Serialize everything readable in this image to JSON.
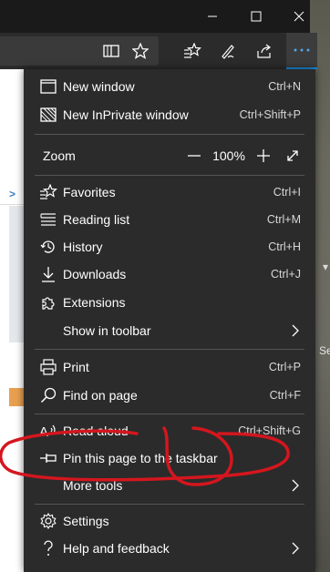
{
  "window": {
    "controls": [
      "minimize",
      "maximize",
      "close"
    ]
  },
  "toolbar": {
    "icons": [
      "reading-view-icon",
      "favorite-star-icon",
      "favorites-hub-icon",
      "pen-icon",
      "share-icon",
      "more-icon"
    ]
  },
  "menu": {
    "new_window": {
      "label": "New window",
      "shortcut": "Ctrl+N"
    },
    "new_inprivate": {
      "label": "New InPrivate window",
      "shortcut": "Ctrl+Shift+P"
    },
    "zoom": {
      "label": "Zoom",
      "value": "100%",
      "minus": "—",
      "plus": "+"
    },
    "favorites": {
      "label": "Favorites",
      "shortcut": "Ctrl+I"
    },
    "reading_list": {
      "label": "Reading list",
      "shortcut": "Ctrl+M"
    },
    "history": {
      "label": "History",
      "shortcut": "Ctrl+H"
    },
    "downloads": {
      "label": "Downloads",
      "shortcut": "Ctrl+J"
    },
    "extensions": {
      "label": "Extensions"
    },
    "show_in_toolbar": {
      "label": "Show in toolbar"
    },
    "print": {
      "label": "Print",
      "shortcut": "Ctrl+P"
    },
    "find_on_page": {
      "label": "Find on page",
      "shortcut": "Ctrl+F"
    },
    "read_aloud": {
      "label": "Read aloud",
      "shortcut": "Ctrl+Shift+G"
    },
    "pin_taskbar": {
      "label": "Pin this page to the taskbar"
    },
    "more_tools": {
      "label": "More tools"
    },
    "settings": {
      "label": "Settings"
    },
    "help": {
      "label": "Help and feedback"
    }
  },
  "background": {
    "page_link_glyph": ">",
    "right_text": "Se"
  },
  "colors": {
    "menu_bg": "#2b2b2b",
    "accent": "#1a8de0",
    "annotation": "#d4161e"
  }
}
